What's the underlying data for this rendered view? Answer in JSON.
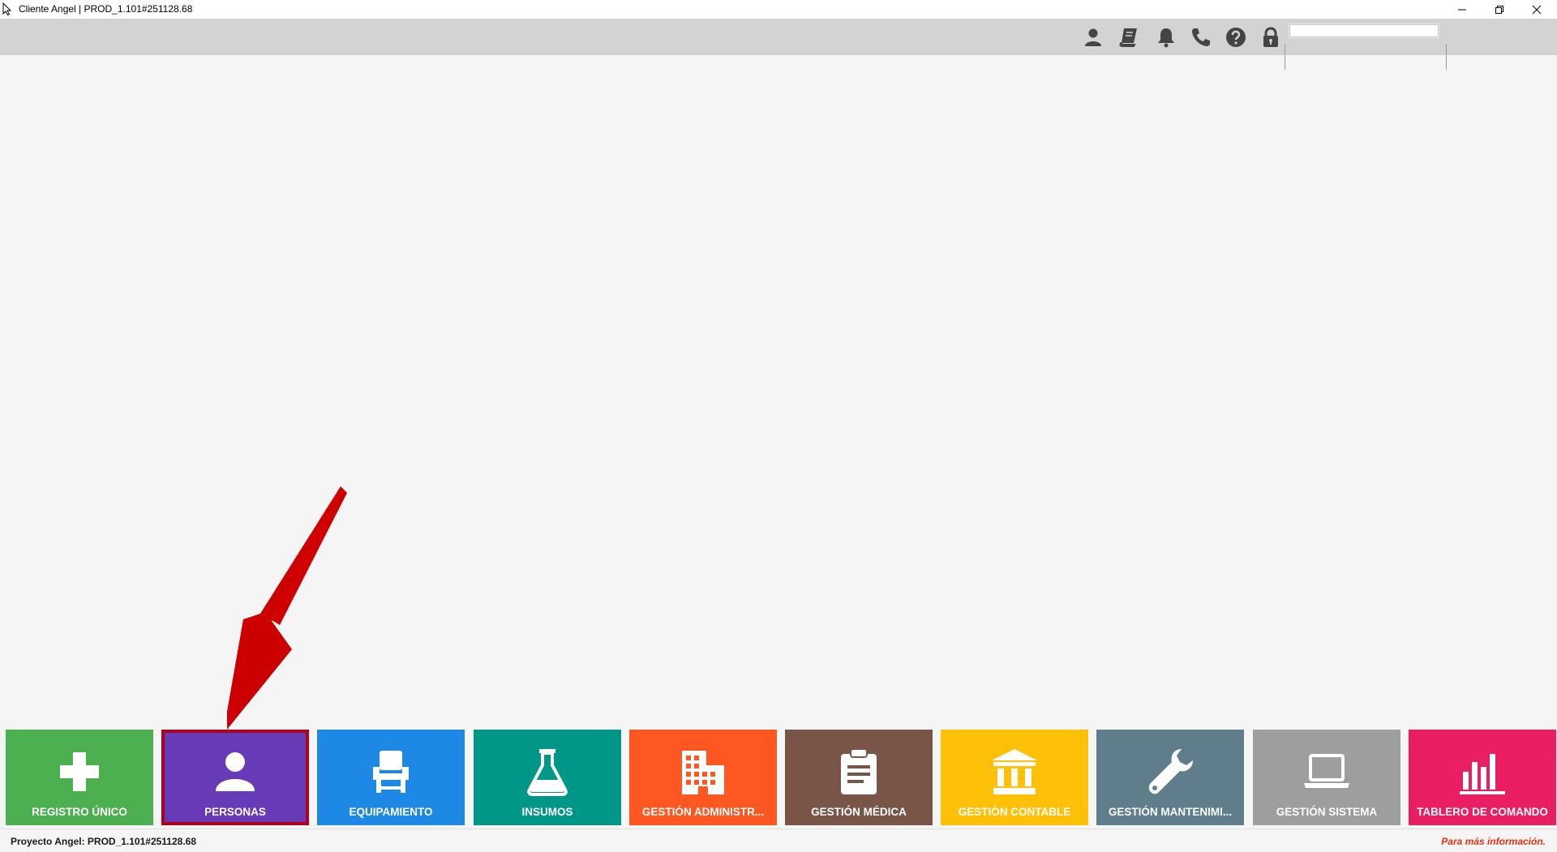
{
  "window": {
    "title": "Cliente Angel | PROD_1.101#251128.68"
  },
  "toolbar": {
    "icons": [
      "user-icon",
      "book-icon",
      "bell-icon",
      "phone-icon",
      "help-icon",
      "lock-icon"
    ],
    "search_value": "",
    "icon_color": "#444444"
  },
  "tiles": [
    {
      "id": "registro-unico",
      "label": "REGISTRO ÚNICO",
      "icon": "plus-icon",
      "color": "#4caf50"
    },
    {
      "id": "personas",
      "label": "PERSONAS",
      "icon": "person-icon",
      "color": "#673ab7",
      "selected": true
    },
    {
      "id": "equipamiento",
      "label": "EQUIPAMIENTO",
      "icon": "chair-icon",
      "color": "#1e88e5"
    },
    {
      "id": "insumos",
      "label": "INSUMOS",
      "icon": "flask-icon",
      "color": "#009688"
    },
    {
      "id": "gestion-administrativa",
      "label": "GESTIÓN ADMINISTR...",
      "icon": "building-icon",
      "color": "#ff5722"
    },
    {
      "id": "gestion-medica",
      "label": "GESTIÓN MÉDICA",
      "icon": "clipboard-icon",
      "color": "#795548"
    },
    {
      "id": "gestion-contable",
      "label": "GESTIÓN CONTABLE",
      "icon": "bank-icon",
      "color": "#ffc107"
    },
    {
      "id": "gestion-mantenimiento",
      "label": "GESTIÓN MANTENIMI...",
      "icon": "wrench-icon",
      "color": "#607d8b"
    },
    {
      "id": "gestion-sistema",
      "label": "GESTIÓN SISTEMA",
      "icon": "laptop-icon",
      "color": "#9e9e9e"
    },
    {
      "id": "tablero-de-comando",
      "label": "TABLERO DE COMANDO",
      "icon": "bar-chart-icon",
      "color": "#e91e63"
    }
  ],
  "statusbar": {
    "left_text": "Proyecto Angel: PROD_1.101#251128.68",
    "right_text": "Para más información."
  },
  "annotation": {
    "arrow_color": "#cc0000",
    "selection_border_color": "#b0001e"
  }
}
